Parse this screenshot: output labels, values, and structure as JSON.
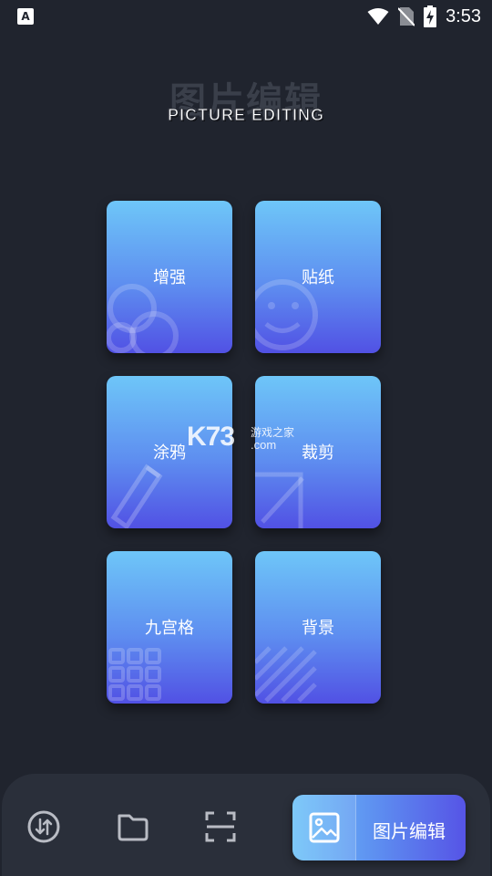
{
  "status_bar": {
    "app_icon_letter": "A",
    "time": "3:53"
  },
  "header": {
    "title_cn": "图片编辑",
    "subtitle": "PICTURE EDITING"
  },
  "tools": [
    {
      "label": "增强",
      "icon": "circles-icon"
    },
    {
      "label": "贴纸",
      "icon": "smiley-icon"
    },
    {
      "label": "涂鸦",
      "icon": "pencil-icon"
    },
    {
      "label": "裁剪",
      "icon": "crop-icon"
    },
    {
      "label": "九宫格",
      "icon": "grid-icon"
    },
    {
      "label": "背景",
      "icon": "stripes-icon"
    }
  ],
  "watermark": {
    "brand": "K73",
    "tagline": "游戏之家",
    "domain": ".com"
  },
  "bottom_nav": {
    "items": [
      {
        "icon": "swap-icon"
      },
      {
        "icon": "folder-icon"
      },
      {
        "icon": "scan-icon"
      }
    ],
    "active": {
      "label": "图片编辑",
      "icon": "image-icon"
    }
  }
}
